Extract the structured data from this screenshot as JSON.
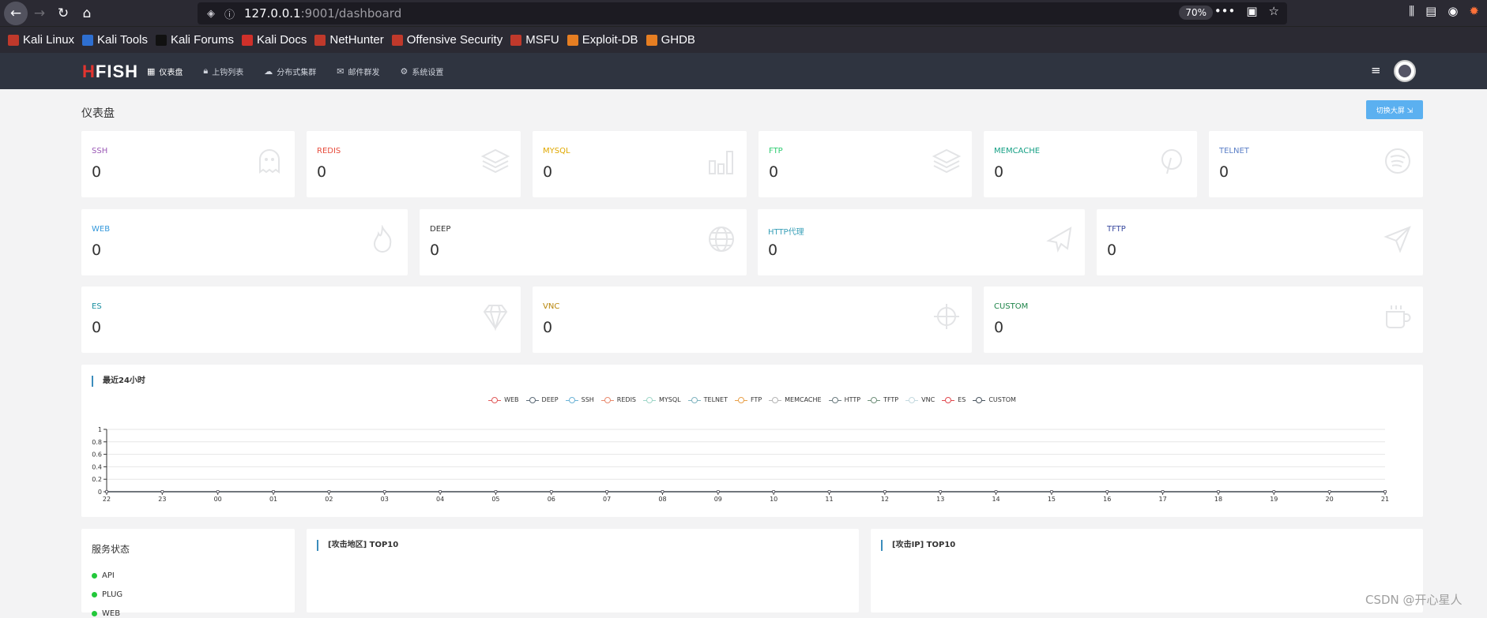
{
  "browser": {
    "url_main": "127.0.0.1",
    "url_rest": ":9001/dashboard",
    "zoom": "70%",
    "bookmarks": [
      "Kali Linux",
      "Kali Tools",
      "Kali Forums",
      "Kali Docs",
      "NetHunter",
      "Offensive Security",
      "MSFU",
      "Exploit-DB",
      "GHDB"
    ]
  },
  "app": {
    "logo_h": "H",
    "logo_rest": "FISH",
    "nav": [
      "仪表盘",
      "上钩列表",
      "分布式集群",
      "邮件群发",
      "系统设置"
    ]
  },
  "page": {
    "title": "仪表盘",
    "big_screen_button": "切换大屏 ⇲"
  },
  "cards_row1": [
    {
      "label": "SSH",
      "value": "0",
      "color": "#9b59b6",
      "icon": "ghost-icon"
    },
    {
      "label": "REDIS",
      "value": "0",
      "color": "#e74c3c",
      "icon": "layers-icon"
    },
    {
      "label": "MYSQL",
      "value": "0",
      "color": "#f0b429",
      "icon": "bar-chart-icon"
    },
    {
      "label": "FTP",
      "value": "0",
      "color": "#2ecc71",
      "icon": "layers-icon"
    },
    {
      "label": "MEMCACHE",
      "value": "0",
      "color": "#16a085",
      "icon": "pinterest-icon"
    },
    {
      "label": "TELNET",
      "value": "0",
      "color": "#5b7fc7",
      "icon": "spotify-icon"
    }
  ],
  "cards_row2": [
    {
      "label": "WEB",
      "value": "0",
      "color": "#3498db",
      "icon": "fire-icon"
    },
    {
      "label": "DEEP",
      "value": "0",
      "color": "#333333",
      "icon": "globe-icon"
    },
    {
      "label": "HTTP代理",
      "value": "0",
      "color": "#3aa0b8",
      "icon": "plane-icon"
    },
    {
      "label": "TFTP",
      "value": "0",
      "color": "#3a4a9f",
      "icon": "send-icon"
    }
  ],
  "cards_row3": [
    {
      "label": "ES",
      "value": "0",
      "color": "#1a8fa0",
      "icon": "diamond-icon"
    },
    {
      "label": "VNC",
      "value": "0",
      "color": "#b8860b",
      "icon": "crosshair-icon"
    },
    {
      "label": "CUSTOM",
      "value": "0",
      "color": "#1e8449",
      "icon": "coffee-icon"
    }
  ],
  "chart_data": {
    "type": "line",
    "title": "最近24小时",
    "categories": [
      "22",
      "23",
      "00",
      "01",
      "02",
      "03",
      "04",
      "05",
      "06",
      "07",
      "08",
      "09",
      "10",
      "11",
      "12",
      "13",
      "14",
      "15",
      "16",
      "17",
      "18",
      "19",
      "20",
      "21"
    ],
    "ylim": [
      0,
      1
    ],
    "yticks": [
      "0",
      "0.2",
      "0.4",
      "0.6",
      "0.8",
      "1"
    ],
    "series": [
      {
        "name": "WEB",
        "color": "#e05a5a",
        "values": [
          0,
          0,
          0,
          0,
          0,
          0,
          0,
          0,
          0,
          0,
          0,
          0,
          0,
          0,
          0,
          0,
          0,
          0,
          0,
          0,
          0,
          0,
          0,
          0
        ]
      },
      {
        "name": "DEEP",
        "color": "#5d6b78",
        "values": [
          0,
          0,
          0,
          0,
          0,
          0,
          0,
          0,
          0,
          0,
          0,
          0,
          0,
          0,
          0,
          0,
          0,
          0,
          0,
          0,
          0,
          0,
          0,
          0
        ]
      },
      {
        "name": "SSH",
        "color": "#6cb3d6",
        "values": [
          0,
          0,
          0,
          0,
          0,
          0,
          0,
          0,
          0,
          0,
          0,
          0,
          0,
          0,
          0,
          0,
          0,
          0,
          0,
          0,
          0,
          0,
          0,
          0
        ]
      },
      {
        "name": "REDIS",
        "color": "#e8896d",
        "values": [
          0,
          0,
          0,
          0,
          0,
          0,
          0,
          0,
          0,
          0,
          0,
          0,
          0,
          0,
          0,
          0,
          0,
          0,
          0,
          0,
          0,
          0,
          0,
          0
        ]
      },
      {
        "name": "MYSQL",
        "color": "#9fd6c8",
        "values": [
          0,
          0,
          0,
          0,
          0,
          0,
          0,
          0,
          0,
          0,
          0,
          0,
          0,
          0,
          0,
          0,
          0,
          0,
          0,
          0,
          0,
          0,
          0,
          0
        ]
      },
      {
        "name": "TELNET",
        "color": "#7fb3bf",
        "values": [
          0,
          0,
          0,
          0,
          0,
          0,
          0,
          0,
          0,
          0,
          0,
          0,
          0,
          0,
          0,
          0,
          0,
          0,
          0,
          0,
          0,
          0,
          0,
          0
        ]
      },
      {
        "name": "FTP",
        "color": "#e8a04a",
        "values": [
          0,
          0,
          0,
          0,
          0,
          0,
          0,
          0,
          0,
          0,
          0,
          0,
          0,
          0,
          0,
          0,
          0,
          0,
          0,
          0,
          0,
          0,
          0,
          0
        ]
      },
      {
        "name": "MEMCACHE",
        "color": "#b5b5b5",
        "values": [
          0,
          0,
          0,
          0,
          0,
          0,
          0,
          0,
          0,
          0,
          0,
          0,
          0,
          0,
          0,
          0,
          0,
          0,
          0,
          0,
          0,
          0,
          0,
          0
        ]
      },
      {
        "name": "HTTP",
        "color": "#6b7b7f",
        "values": [
          0,
          0,
          0,
          0,
          0,
          0,
          0,
          0,
          0,
          0,
          0,
          0,
          0,
          0,
          0,
          0,
          0,
          0,
          0,
          0,
          0,
          0,
          0,
          0
        ]
      },
      {
        "name": "TFTP",
        "color": "#6f8f7a",
        "values": [
          0,
          0,
          0,
          0,
          0,
          0,
          0,
          0,
          0,
          0,
          0,
          0,
          0,
          0,
          0,
          0,
          0,
          0,
          0,
          0,
          0,
          0,
          0,
          0
        ]
      },
      {
        "name": "VNC",
        "color": "#c4d9df",
        "values": [
          0,
          0,
          0,
          0,
          0,
          0,
          0,
          0,
          0,
          0,
          0,
          0,
          0,
          0,
          0,
          0,
          0,
          0,
          0,
          0,
          0,
          0,
          0,
          0
        ]
      },
      {
        "name": "ES",
        "color": "#e0484e",
        "values": [
          0,
          0,
          0,
          0,
          0,
          0,
          0,
          0,
          0,
          0,
          0,
          0,
          0,
          0,
          0,
          0,
          0,
          0,
          0,
          0,
          0,
          0,
          0,
          0
        ]
      },
      {
        "name": "CUSTOM",
        "color": "#4a5560",
        "values": [
          0,
          0,
          0,
          0,
          0,
          0,
          0,
          0,
          0,
          0,
          0,
          0,
          0,
          0,
          0,
          0,
          0,
          0,
          0,
          0,
          0,
          0,
          0,
          0
        ]
      }
    ],
    "grid": true,
    "legend": "top-center"
  },
  "services": {
    "title": "服务状态",
    "items": [
      "API",
      "PLUG",
      "WEB"
    ]
  },
  "panels": {
    "region_title": "[攻击地区] TOP10",
    "ip_title": "[攻击IP] TOP10"
  },
  "watermark": "CSDN @开心星人"
}
